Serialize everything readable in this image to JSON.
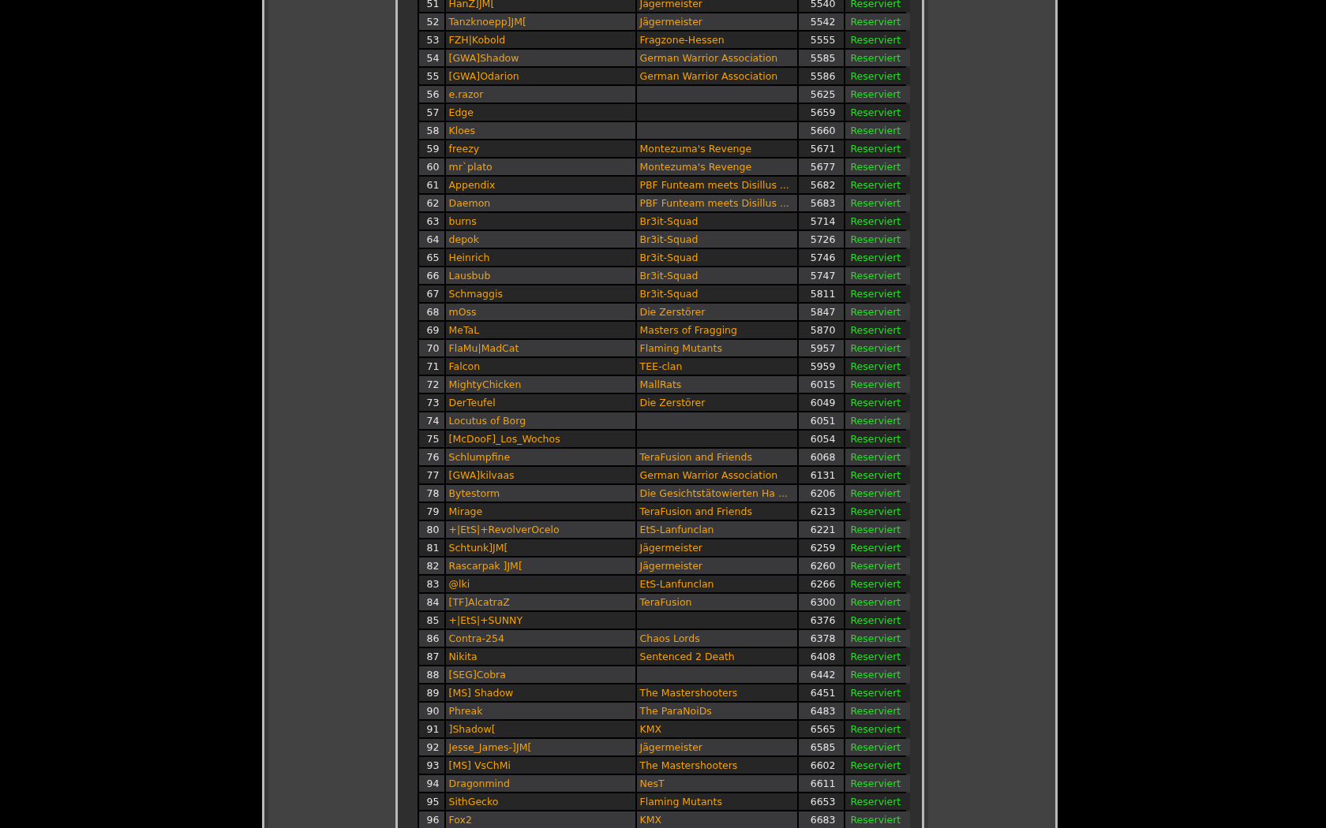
{
  "table": {
    "rows": [
      {
        "nr": "51",
        "player": "HanZ]JM[",
        "clan": "Jägermeister",
        "seat": "5540",
        "status": "Reserviert"
      },
      {
        "nr": "52",
        "player": "Tanzknoepp]JM[",
        "clan": "Jägermeister",
        "seat": "5542",
        "status": "Reserviert"
      },
      {
        "nr": "53",
        "player": "FZH|Kobold",
        "clan": "Fragzone-Hessen",
        "seat": "5555",
        "status": "Reserviert"
      },
      {
        "nr": "54",
        "player": "[GWA]Shadow",
        "clan": "German Warrior Association",
        "seat": "5585",
        "status": "Reserviert"
      },
      {
        "nr": "55",
        "player": "[GWA]Odarion",
        "clan": "German Warrior Association",
        "seat": "5586",
        "status": "Reserviert"
      },
      {
        "nr": "56",
        "player": "e.razor",
        "seat": "5625",
        "status": "Reserviert"
      },
      {
        "nr": "57",
        "player": "Edge",
        "seat": "5659",
        "status": "Reserviert"
      },
      {
        "nr": "58",
        "player": "Kloes",
        "seat": "5660",
        "status": "Reserviert"
      },
      {
        "nr": "59",
        "player": "freezy",
        "clan": "Montezuma's Revenge",
        "seat": "5671",
        "status": "Reserviert"
      },
      {
        "nr": "60",
        "player": "mr`plato",
        "clan": "Montezuma's Revenge",
        "seat": "5677",
        "status": "Reserviert"
      },
      {
        "nr": "61",
        "player": "Appendix",
        "clan": "PBF Funteam meets Disillus ...",
        "seat": "5682",
        "status": "Reserviert"
      },
      {
        "nr": "62",
        "player": "Daemon",
        "clan": "PBF Funteam meets Disillus ...",
        "seat": "5683",
        "status": "Reserviert"
      },
      {
        "nr": "63",
        "player": "burns",
        "clan": "Br3it-Squad",
        "seat": "5714",
        "status": "Reserviert"
      },
      {
        "nr": "64",
        "player": "depok",
        "clan": "Br3it-Squad",
        "seat": "5726",
        "status": "Reserviert"
      },
      {
        "nr": "65",
        "player": "Heinrich",
        "clan": "Br3it-Squad",
        "seat": "5746",
        "status": "Reserviert"
      },
      {
        "nr": "66",
        "player": "Lausbub",
        "clan": "Br3it-Squad",
        "seat": "5747",
        "status": "Reserviert"
      },
      {
        "nr": "67",
        "player": "Schmaggis",
        "clan": "Br3it-Squad",
        "seat": "5811",
        "status": "Reserviert"
      },
      {
        "nr": "68",
        "player": "mOss",
        "clan": "Die Zerstörer",
        "seat": "5847",
        "status": "Reserviert"
      },
      {
        "nr": "69",
        "player": "MeTaL",
        "clan": "Masters of Fragging",
        "seat": "5870",
        "status": "Reserviert"
      },
      {
        "nr": "70",
        "player": "FlaMu|MadCat",
        "clan": "Flaming Mutants",
        "seat": "5957",
        "status": "Reserviert"
      },
      {
        "nr": "71",
        "player": "Falcon",
        "clan": "TEE-clan",
        "seat": "5959",
        "status": "Reserviert"
      },
      {
        "nr": "72",
        "player": "MightyChicken",
        "clan": "MallRats",
        "seat": "6015",
        "status": "Reserviert"
      },
      {
        "nr": "73",
        "player": "DerTeufel",
        "clan": "Die Zerstörer",
        "seat": "6049",
        "status": "Reserviert"
      },
      {
        "nr": "74",
        "player": "Locutus of Borg",
        "seat": "6051",
        "status": "Reserviert"
      },
      {
        "nr": "75",
        "player": "[McDooF]_Los_Wochos",
        "seat": "6054",
        "status": "Reserviert"
      },
      {
        "nr": "76",
        "player": "Schlumpfine",
        "clan": "TeraFusion and Friends",
        "seat": "6068",
        "status": "Reserviert"
      },
      {
        "nr": "77",
        "player": "[GWA]kilvaas",
        "clan": "German Warrior Association",
        "seat": "6131",
        "status": "Reserviert"
      },
      {
        "nr": "78",
        "player": "Bytestorm",
        "clan": "Die Gesichtstätowierten Ha ...",
        "seat": "6206",
        "status": "Reserviert"
      },
      {
        "nr": "79",
        "player": "Mirage",
        "clan": "TeraFusion and Friends",
        "seat": "6213",
        "status": "Reserviert"
      },
      {
        "nr": "80",
        "player": "+|EtS|+RevolverOcelo",
        "clan": "EtS-Lanfunclan",
        "seat": "6221",
        "status": "Reserviert"
      },
      {
        "nr": "81",
        "player": "Schtunk]JM[",
        "clan": "Jägermeister",
        "seat": "6259",
        "status": "Reserviert"
      },
      {
        "nr": "82",
        "player": "Rascarpak ]JM[",
        "clan": "Jägermeister",
        "seat": "6260",
        "status": "Reserviert"
      },
      {
        "nr": "83",
        "player": "@lki",
        "clan": "EtS-Lanfunclan",
        "seat": "6266",
        "status": "Reserviert"
      },
      {
        "nr": "84",
        "player": "[TF]AlcatraZ",
        "clan": "TeraFusion",
        "seat": "6300",
        "status": "Reserviert"
      },
      {
        "nr": "85",
        "player": "+|EtS|+SUNNY",
        "seat": "6376",
        "status": "Reserviert"
      },
      {
        "nr": "86",
        "player": "Contra-254",
        "clan": "Chaos Lords",
        "seat": "6378",
        "status": "Reserviert"
      },
      {
        "nr": "87",
        "player": "Nikita",
        "clan": "Sentenced 2 Death",
        "seat": "6408",
        "status": "Reserviert"
      },
      {
        "nr": "88",
        "player": "[SEG]Cobra",
        "seat": "6442",
        "status": "Reserviert"
      },
      {
        "nr": "89",
        "player": "[MS] Shadow",
        "clan": "The Mastershooters",
        "seat": "6451",
        "status": "Reserviert"
      },
      {
        "nr": "90",
        "player": "Phreak",
        "clan": "The ParaNoiDs",
        "seat": "6483",
        "status": "Reserviert"
      },
      {
        "nr": "91",
        "player": "]Shadow[",
        "clan": "KMX",
        "seat": "6565",
        "status": "Reserviert"
      },
      {
        "nr": "92",
        "player": "Jesse_James-]JM[",
        "clan": "Jägermeister",
        "seat": "6585",
        "status": "Reserviert"
      },
      {
        "nr": "93",
        "player": "[MS] VsChMi",
        "clan": "The Mastershooters",
        "seat": "6602",
        "status": "Reserviert"
      },
      {
        "nr": "94",
        "player": "Dragonmind",
        "clan": "NesT",
        "seat": "6611",
        "status": "Reserviert"
      },
      {
        "nr": "95",
        "player": "SithGecko",
        "clan": "Flaming Mutants",
        "seat": "6653",
        "status": "Reserviert"
      },
      {
        "nr": "96",
        "player": "Fox2",
        "clan": "KMX",
        "seat": "6683",
        "status": "Reserviert"
      }
    ]
  }
}
